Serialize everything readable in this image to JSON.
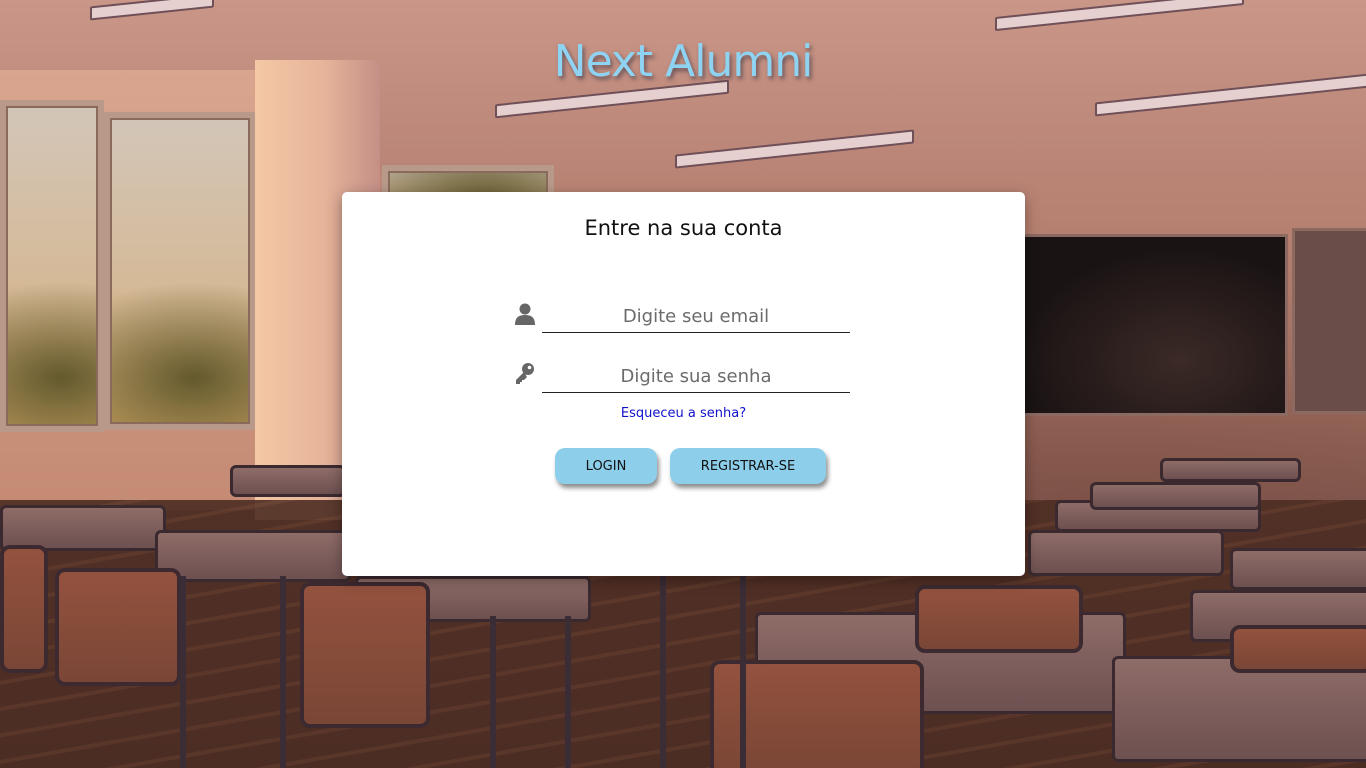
{
  "app": {
    "title": "Next Alumni"
  },
  "login_card": {
    "title": "Entre na sua conta",
    "email_field": {
      "icon": "user-icon",
      "placeholder": "Digite seu email",
      "value": ""
    },
    "password_field": {
      "icon": "key-icon",
      "placeholder": "Digite sua senha",
      "value": ""
    },
    "forgot_password_link": "Esqueceu a senha?",
    "login_button": "LOGIN",
    "register_button": "REGISTRAR-SE"
  },
  "colors": {
    "title_accent": "#8fd3f2",
    "button_bg": "#8dcfeb",
    "link": "#1111cc",
    "icon": "#666666"
  }
}
